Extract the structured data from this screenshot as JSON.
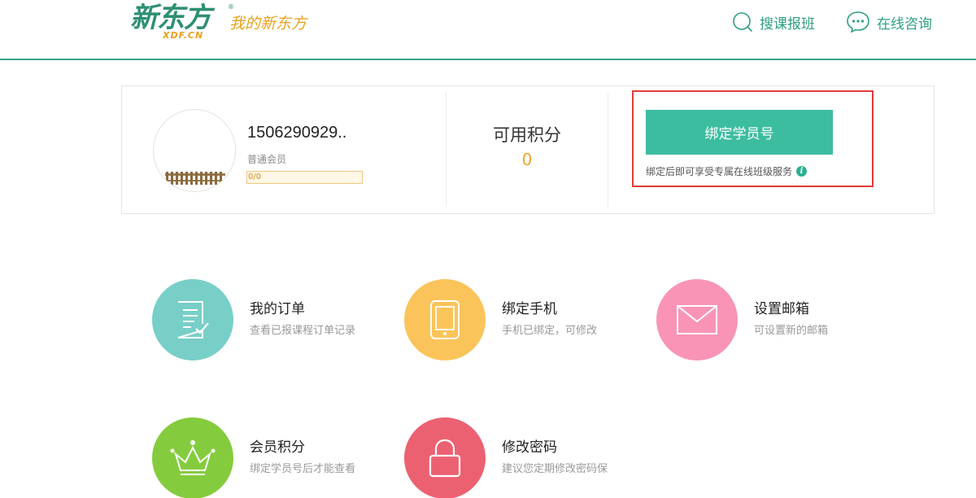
{
  "header": {
    "logo_text": "新东方",
    "logo_registered": "®",
    "logo_domain": "XDF.CN",
    "logo_tagline": "我的新东方",
    "nav": [
      {
        "label": "搜课报班",
        "icon": "search-icon"
      },
      {
        "label": "在线咨询",
        "icon": "chat-bubble-icon"
      }
    ]
  },
  "profile": {
    "username": "1506290929..",
    "level": "普通会员",
    "progress_text": "0/0",
    "progress_fraction": 0
  },
  "points": {
    "label": "可用积分",
    "value": "0"
  },
  "bind": {
    "button_label": "绑定学员号",
    "tip": "绑定后即可享受专属在线班级服务",
    "info_icon_glyph": "i"
  },
  "tiles": [
    {
      "title": "我的订单",
      "desc": "查看已报课程订单记录",
      "color": "#77cfc8",
      "icon": "order-list-icon"
    },
    {
      "title": "绑定手机",
      "desc": "手机已绑定，可修改",
      "color": "#fbc45a",
      "icon": "tablet-icon"
    },
    {
      "title": "设置邮箱",
      "desc": "可设置新的邮箱",
      "color": "#f994b7",
      "icon": "envelope-icon"
    },
    {
      "title": "会员积分",
      "desc": "绑定学员号后才能查看",
      "color": "#84cc3e",
      "icon": "crown-icon"
    },
    {
      "title": "修改密码",
      "desc": "建议您定期修改密码保",
      "color": "#ec6171",
      "icon": "lock-icon"
    }
  ],
  "colors": {
    "brand_green": "#3dbda0",
    "header_border": "#3aa88f",
    "points_orange": "#f2a32b",
    "highlight_red": "#e03c3c"
  }
}
